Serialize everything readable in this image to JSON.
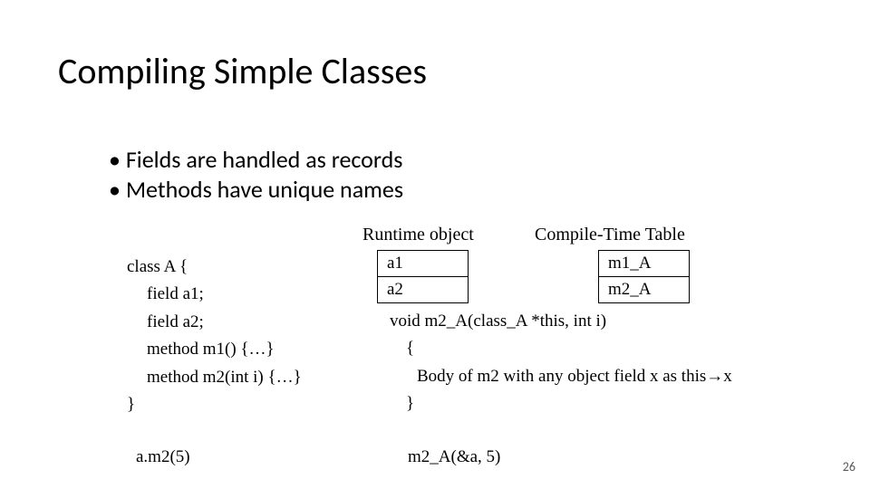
{
  "title": "Compiling Simple Classes",
  "bullets": {
    "b1": "Fields are handled as records",
    "b2": "Methods have unique names"
  },
  "labels": {
    "runtime": "Runtime object",
    "compiletime": "Compile-Time Table"
  },
  "code_left": {
    "l1": "class A {",
    "l2": "field a1;",
    "l3": "field a2;",
    "l4": "method m1() {…}",
    "l5": "method m2(int i) {…}",
    "l6": "}"
  },
  "runtime_table": {
    "r1": "a1",
    "r2": "a2"
  },
  "compile_table": {
    "r1": "m1_A",
    "r2": "m2_A"
  },
  "code_right": {
    "sig": "void m2_A(class_A  *this, int i)",
    "open": "{",
    "body_pre": "Body of m2 with any object field x as this",
    "body_post": "x",
    "close": "}"
  },
  "calls": {
    "left": "a.m2(5)",
    "right": "m2_A(&a, 5)"
  },
  "page_number": "26"
}
